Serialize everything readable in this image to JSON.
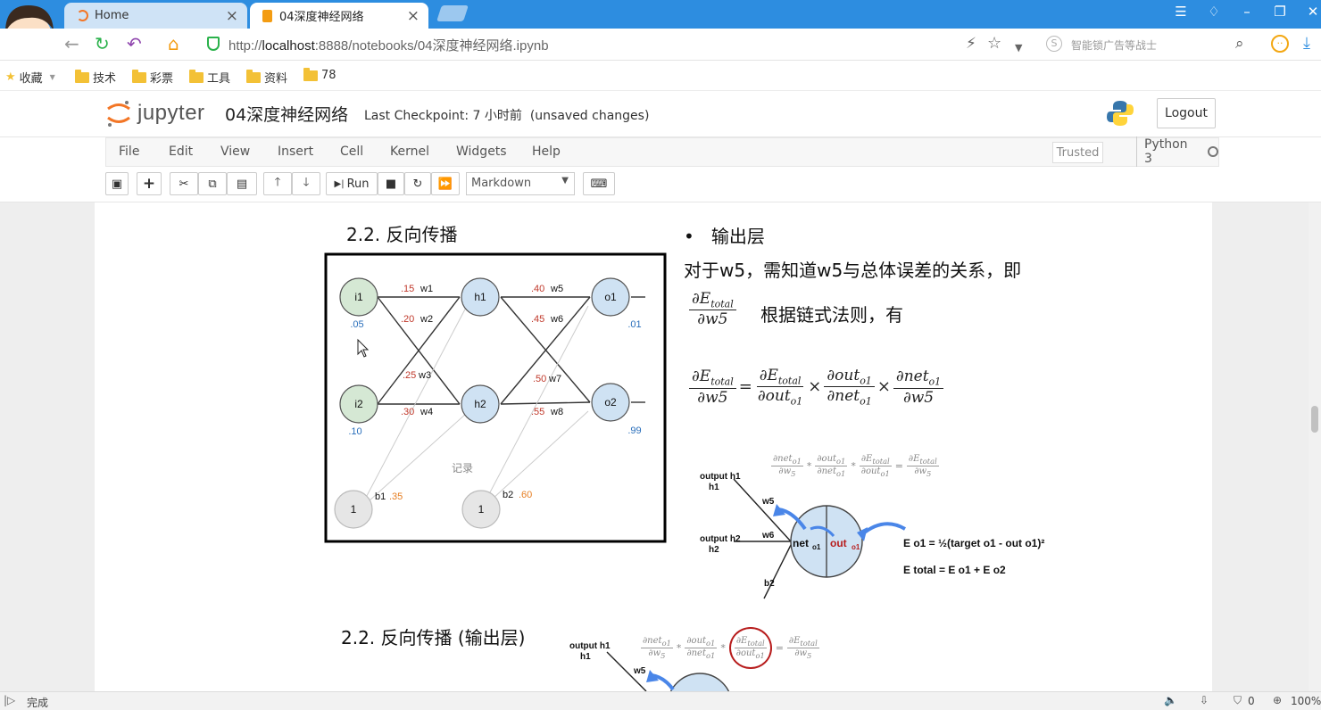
{
  "browser": {
    "tabs": [
      {
        "label": "Home"
      },
      {
        "label": "04深度神经网络"
      }
    ],
    "url_prefix": "http://",
    "url_host": "localhost",
    "url_rest": ":8888/notebooks/04深度神经网络.ipynb",
    "search_placeholder": "智能锁广告等战士",
    "bookmarks": [
      "收藏",
      "技术",
      "彩票",
      "工具",
      "资料",
      "78"
    ]
  },
  "jupyter": {
    "logo_text": "jupyter",
    "notebook_title": "04深度神经网络",
    "checkpoint": "Last Checkpoint: 7 小时前",
    "unsaved": "(unsaved changes)",
    "logout": "Logout",
    "menus": [
      "File",
      "Edit",
      "View",
      "Insert",
      "Cell",
      "Kernel",
      "Widgets",
      "Help"
    ],
    "trusted": "Trusted",
    "kernel": "Python 3",
    "run_label": "Run",
    "cell_type": "Markdown"
  },
  "slide": {
    "section_title": "2.2. 反向传播",
    "section_title2": "2.2. 反向传播 (输出层)",
    "bullet": "输出层",
    "text1": "对于w5，需知道w5与总体误差的关系，即",
    "text2": "根据链式法则，有",
    "watermark": "记录",
    "network": {
      "inputs": [
        {
          "label": "i1",
          "value": ".05"
        },
        {
          "label": "i2",
          "value": ".10"
        }
      ],
      "hidden": [
        {
          "label": "h1"
        },
        {
          "label": "h2"
        }
      ],
      "outputs": [
        {
          "label": "o1",
          "value": ".01"
        },
        {
          "label": "o2",
          "value": ".99"
        }
      ],
      "biases": [
        {
          "node": "1",
          "label": "b1",
          "value": ".35"
        },
        {
          "node": "1",
          "label": "b2",
          "value": ".60"
        }
      ],
      "weights": [
        {
          "value": ".15",
          "name": "w1"
        },
        {
          "value": ".20",
          "name": "w2"
        },
        {
          "value": ".25",
          "name": "w3"
        },
        {
          "value": ".30",
          "name": "w4"
        },
        {
          "value": ".40",
          "name": "w5"
        },
        {
          "value": ".45",
          "name": "w6"
        },
        {
          "value": ".50",
          "name": "w7"
        },
        {
          "value": ".55",
          "name": "w8"
        }
      ]
    },
    "neuron_diagram": {
      "labels": [
        "output h1",
        "output h2",
        "w5",
        "w6",
        "b2"
      ],
      "net": "net",
      "out": "out",
      "sub": "o1",
      "eq1": "E o1 = ½(target o1 - out o1)²",
      "eq2": "E total = E o1 + E o2"
    },
    "neuron_diagram2_labels": [
      "output h1",
      "w5"
    ]
  },
  "status": {
    "left": "完成",
    "zoom": "100%",
    "count": "0"
  }
}
